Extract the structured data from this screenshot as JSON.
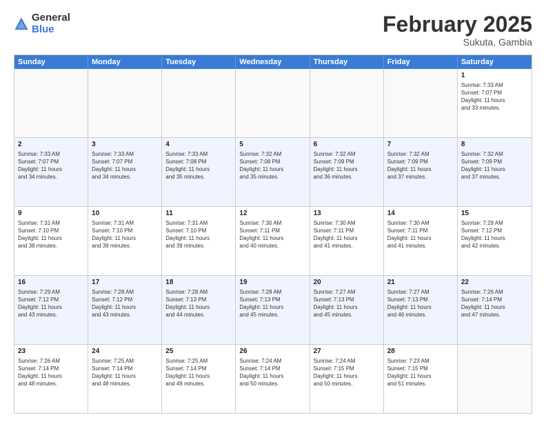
{
  "logo": {
    "general": "General",
    "blue": "Blue"
  },
  "title": "February 2025",
  "subtitle": "Sukuta, Gambia",
  "days": [
    "Sunday",
    "Monday",
    "Tuesday",
    "Wednesday",
    "Thursday",
    "Friday",
    "Saturday"
  ],
  "rows": [
    [
      {
        "day": "",
        "text": "",
        "empty": true
      },
      {
        "day": "",
        "text": "",
        "empty": true
      },
      {
        "day": "",
        "text": "",
        "empty": true
      },
      {
        "day": "",
        "text": "",
        "empty": true
      },
      {
        "day": "",
        "text": "",
        "empty": true
      },
      {
        "day": "",
        "text": "",
        "empty": true
      },
      {
        "day": "1",
        "text": "Sunrise: 7:33 AM\nSunset: 7:07 PM\nDaylight: 11 hours\nand 33 minutes."
      }
    ],
    [
      {
        "day": "2",
        "text": "Sunrise: 7:33 AM\nSunset: 7:07 PM\nDaylight: 11 hours\nand 34 minutes."
      },
      {
        "day": "3",
        "text": "Sunrise: 7:33 AM\nSunset: 7:07 PM\nDaylight: 11 hours\nand 34 minutes."
      },
      {
        "day": "4",
        "text": "Sunrise: 7:33 AM\nSunset: 7:08 PM\nDaylight: 11 hours\nand 35 minutes."
      },
      {
        "day": "5",
        "text": "Sunrise: 7:32 AM\nSunset: 7:08 PM\nDaylight: 11 hours\nand 35 minutes."
      },
      {
        "day": "6",
        "text": "Sunrise: 7:32 AM\nSunset: 7:09 PM\nDaylight: 11 hours\nand 36 minutes."
      },
      {
        "day": "7",
        "text": "Sunrise: 7:32 AM\nSunset: 7:09 PM\nDaylight: 11 hours\nand 37 minutes."
      },
      {
        "day": "8",
        "text": "Sunrise: 7:32 AM\nSunset: 7:09 PM\nDaylight: 11 hours\nand 37 minutes."
      }
    ],
    [
      {
        "day": "9",
        "text": "Sunrise: 7:31 AM\nSunset: 7:10 PM\nDaylight: 11 hours\nand 38 minutes."
      },
      {
        "day": "10",
        "text": "Sunrise: 7:31 AM\nSunset: 7:10 PM\nDaylight: 11 hours\nand 39 minutes."
      },
      {
        "day": "11",
        "text": "Sunrise: 7:31 AM\nSunset: 7:10 PM\nDaylight: 11 hours\nand 39 minutes."
      },
      {
        "day": "12",
        "text": "Sunrise: 7:30 AM\nSunset: 7:11 PM\nDaylight: 11 hours\nand 40 minutes."
      },
      {
        "day": "13",
        "text": "Sunrise: 7:30 AM\nSunset: 7:11 PM\nDaylight: 11 hours\nand 41 minutes."
      },
      {
        "day": "14",
        "text": "Sunrise: 7:30 AM\nSunset: 7:11 PM\nDaylight: 11 hours\nand 41 minutes."
      },
      {
        "day": "15",
        "text": "Sunrise: 7:29 AM\nSunset: 7:12 PM\nDaylight: 11 hours\nand 42 minutes."
      }
    ],
    [
      {
        "day": "16",
        "text": "Sunrise: 7:29 AM\nSunset: 7:12 PM\nDaylight: 11 hours\nand 43 minutes."
      },
      {
        "day": "17",
        "text": "Sunrise: 7:28 AM\nSunset: 7:12 PM\nDaylight: 11 hours\nand 43 minutes."
      },
      {
        "day": "18",
        "text": "Sunrise: 7:28 AM\nSunset: 7:13 PM\nDaylight: 11 hours\nand 44 minutes."
      },
      {
        "day": "19",
        "text": "Sunrise: 7:28 AM\nSunset: 7:13 PM\nDaylight: 11 hours\nand 45 minutes."
      },
      {
        "day": "20",
        "text": "Sunrise: 7:27 AM\nSunset: 7:13 PM\nDaylight: 11 hours\nand 45 minutes."
      },
      {
        "day": "21",
        "text": "Sunrise: 7:27 AM\nSunset: 7:13 PM\nDaylight: 11 hours\nand 46 minutes."
      },
      {
        "day": "22",
        "text": "Sunrise: 7:26 AM\nSunset: 7:14 PM\nDaylight: 11 hours\nand 47 minutes."
      }
    ],
    [
      {
        "day": "23",
        "text": "Sunrise: 7:26 AM\nSunset: 7:14 PM\nDaylight: 11 hours\nand 48 minutes."
      },
      {
        "day": "24",
        "text": "Sunrise: 7:25 AM\nSunset: 7:14 PM\nDaylight: 11 hours\nand 48 minutes."
      },
      {
        "day": "25",
        "text": "Sunrise: 7:25 AM\nSunset: 7:14 PM\nDaylight: 11 hours\nand 49 minutes."
      },
      {
        "day": "26",
        "text": "Sunrise: 7:24 AM\nSunset: 7:14 PM\nDaylight: 11 hours\nand 50 minutes."
      },
      {
        "day": "27",
        "text": "Sunrise: 7:24 AM\nSunset: 7:15 PM\nDaylight: 11 hours\nand 50 minutes."
      },
      {
        "day": "28",
        "text": "Sunrise: 7:23 AM\nSunset: 7:15 PM\nDaylight: 11 hours\nand 51 minutes."
      },
      {
        "day": "",
        "text": "",
        "empty": true
      }
    ]
  ]
}
